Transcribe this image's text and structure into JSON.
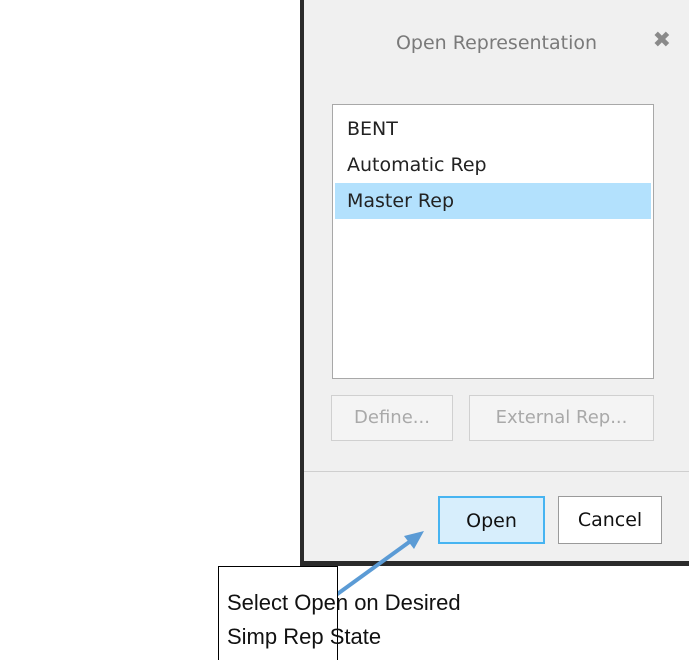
{
  "dialog": {
    "title": "Open Representation",
    "close_glyph": "✖",
    "list_items": [
      {
        "label": "BENT",
        "selected": false
      },
      {
        "label": "Automatic Rep",
        "selected": false
      },
      {
        "label": "Master Rep",
        "selected": true
      }
    ],
    "define_label": "Define...",
    "external_label": "External Rep...",
    "open_label": "Open",
    "cancel_label": "Cancel"
  },
  "annotation": {
    "line1": "Select Open on Desired",
    "line2": "Simp Rep State"
  },
  "colors": {
    "selection": "#b3e1fd",
    "open_border": "#47b4f1",
    "arrow": "#5b9bd5"
  },
  "icons": {
    "close": "close-icon",
    "arrow": "arrow-icon"
  }
}
